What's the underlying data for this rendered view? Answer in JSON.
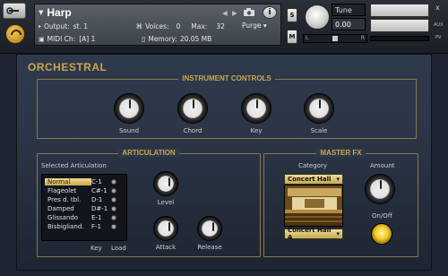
{
  "header": {
    "instrument_name": "Harp",
    "output_label": "Output:",
    "output_value": "st. 1",
    "midi_label": "MIDI Ch:",
    "midi_value": "[A] 1",
    "voices_label": "Voices:",
    "voices_value": "0",
    "max_label": "Max:",
    "max_value": "32",
    "purge_label": "Purge",
    "memory_label": "Memory:",
    "memory_value": "20.05 MB",
    "solo_label": "S",
    "mute_label": "M",
    "tune_label": "Tune",
    "tune_value": "0.00",
    "pan_left": "L",
    "pan_right": "R",
    "close_label": "x",
    "aux_label": "AUX",
    "pv_label": "PV",
    "info_label": "i"
  },
  "panel": {
    "title": "ORCHESTRAL"
  },
  "instrument_controls": {
    "title": "INSTRUMENT CONTROLS",
    "knobs": [
      {
        "label": "Sound"
      },
      {
        "label": "Chord"
      },
      {
        "label": "Key"
      },
      {
        "label": "Scale"
      }
    ]
  },
  "articulation": {
    "title": "ARTICULATION",
    "selected_label": "Selected Articulation",
    "items": [
      {
        "name": "Normal",
        "key": "C-1",
        "selected": true
      },
      {
        "name": "Flageolet",
        "key": "C#-1",
        "selected": false
      },
      {
        "name": "Pres d. tbl.",
        "key": "D-1",
        "selected": false
      },
      {
        "name": "Damped",
        "key": "D#-1",
        "selected": false
      },
      {
        "name": "Glissando",
        "key": "E-1",
        "selected": false
      },
      {
        "name": "Bisbigliand.",
        "key": "F-1",
        "selected": false
      }
    ],
    "key_col": "Key",
    "load_col": "Load",
    "level_label": "Level",
    "attack_label": "Attack",
    "release_label": "Release"
  },
  "master_fx": {
    "title": "MASTER FX",
    "category_label": "Category",
    "category_value": "Concert Hall",
    "preset_value": "Concert Hall A",
    "amount_label": "Amount",
    "onoff_label": "On/Off"
  },
  "colors": {
    "accent_gold": "#c9a64e",
    "panel_bg": "#2b3546",
    "led_on": "#f1c820"
  }
}
